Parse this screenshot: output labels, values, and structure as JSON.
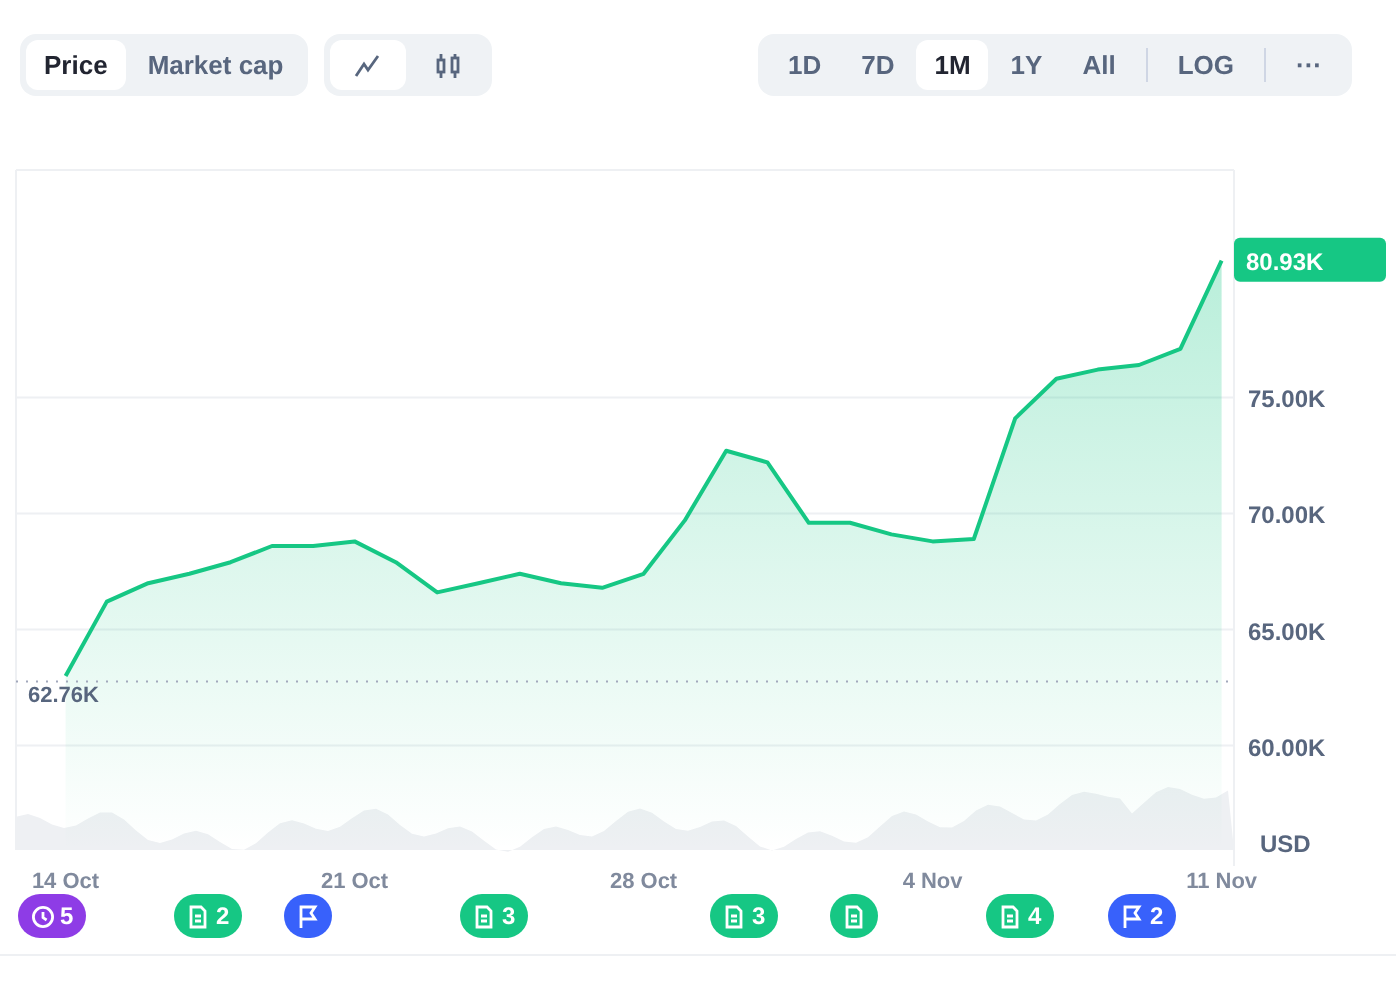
{
  "toolbar": {
    "views": [
      {
        "label": "Price",
        "selected": true
      },
      {
        "label": "Market cap",
        "selected": false
      }
    ],
    "chart_types": [
      {
        "kind": "line",
        "selected": true
      },
      {
        "kind": "candles",
        "selected": false
      }
    ],
    "ranges": [
      {
        "label": "1D",
        "selected": false
      },
      {
        "label": "7D",
        "selected": false
      },
      {
        "label": "1M",
        "selected": true
      },
      {
        "label": "1Y",
        "selected": false
      },
      {
        "label": "All",
        "selected": false
      }
    ],
    "log": {
      "label": "LOG",
      "selected": false
    },
    "more": "···"
  },
  "chart": {
    "current_price": "80.93K",
    "currency": "USD",
    "chart_data": {
      "type": "area",
      "categories": [
        "14 Oct",
        null,
        null,
        null,
        null,
        null,
        null,
        "21 Oct",
        null,
        null,
        null,
        null,
        null,
        null,
        "28 Oct",
        null,
        null,
        null,
        null,
        null,
        null,
        "4 Nov",
        null,
        null,
        null,
        null,
        null,
        null,
        "11 Nov"
      ],
      "series": [
        {
          "color": "#16c784",
          "values": [
            63.0,
            66.2,
            67.0,
            67.4,
            67.9,
            68.6,
            68.6,
            68.8,
            67.9,
            66.6,
            67.0,
            67.4,
            67.0,
            66.8,
            67.4,
            69.7,
            72.7,
            72.2,
            69.6,
            69.6,
            69.1,
            68.8,
            68.9,
            74.1,
            75.8,
            76.2,
            76.4,
            77.1,
            80.9
          ]
        }
      ],
      "ylim": [
        55.5,
        84.8
      ],
      "grid": true,
      "ref_lines": [
        {
          "axis": "y",
          "value": 62.76,
          "label": "62.76K"
        }
      ],
      "yticks": [
        {
          "value": 60,
          "label": "60.00K"
        },
        {
          "value": 65,
          "label": "65.00K"
        },
        {
          "value": 70,
          "label": "70.00K"
        },
        {
          "value": 75,
          "label": "75.00K"
        }
      ]
    }
  },
  "events": [
    {
      "kind": "history",
      "count": "5"
    },
    {
      "kind": "news",
      "count": "2"
    },
    {
      "kind": "flag"
    },
    {
      "kind": "news",
      "count": "3"
    },
    {
      "kind": "news",
      "count": "3"
    },
    {
      "kind": "news"
    },
    {
      "kind": "news",
      "count": "4"
    },
    {
      "kind": "flag",
      "count": "2"
    }
  ]
}
